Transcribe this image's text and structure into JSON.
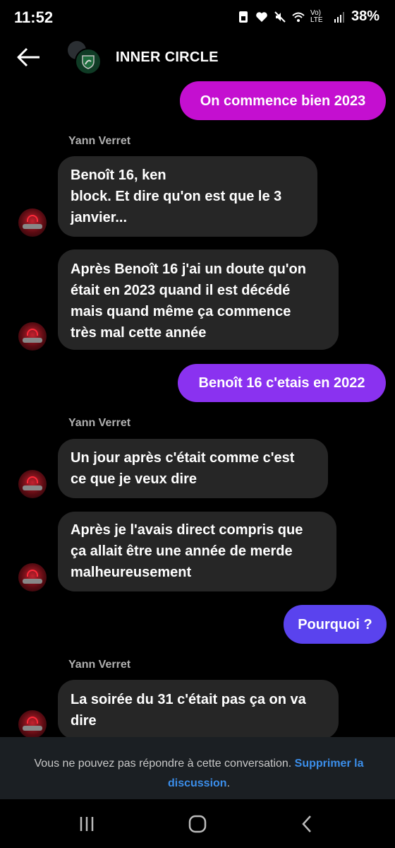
{
  "status_bar": {
    "time": "11:52",
    "network_label": "Vo) LTE",
    "battery": "38%",
    "icons": [
      "sim-icon",
      "heart-icon",
      "mute-icon",
      "wifi-icon",
      "signal-icon"
    ]
  },
  "header": {
    "title": "INNER CIRCLE",
    "back_icon": "arrow-left-icon"
  },
  "messages": [
    {
      "type": "out",
      "text": "On commence bien 2023",
      "color": "#c40fd0"
    },
    {
      "type": "sender",
      "text": "Yann Verret"
    },
    {
      "type": "in",
      "text": "Benoît 16, ken\n block. Et dire qu'on est que le 3\njanvier..."
    },
    {
      "type": "in",
      "text": "Après Benoît 16 j'ai un doute qu'on\nétait en 2023 quand il est décédé\nmais quand même ça commence\ntrès mal cette année"
    },
    {
      "type": "out",
      "text": "Benoît 16 c'etais en 2022",
      "color": "#8a32f0"
    },
    {
      "type": "sender",
      "text": "Yann Verret"
    },
    {
      "type": "in",
      "text": "Un jour après c'était comme c'est\nce que je veux dire"
    },
    {
      "type": "in",
      "text": "Après je l'avais direct compris que\nça allait être une année de merde\nmalheureusement"
    },
    {
      "type": "out",
      "text": "Pourquoi ?",
      "color": "#5a43ee"
    },
    {
      "type": "sender",
      "text": "Yann Verret"
    },
    {
      "type": "in",
      "text": "La soirée du 31 c'était pas ça on va\ndire"
    }
  ],
  "notice": {
    "text": "Vous ne pouvez pas répondre à cette conversation. ",
    "link": "Supprimer la discussion",
    "end": "."
  },
  "colors": {
    "incoming_bubble": "#262626",
    "link": "#3b8eea"
  },
  "navbar": {
    "icons": [
      "recent-apps-icon",
      "home-icon",
      "back-nav-icon"
    ]
  }
}
